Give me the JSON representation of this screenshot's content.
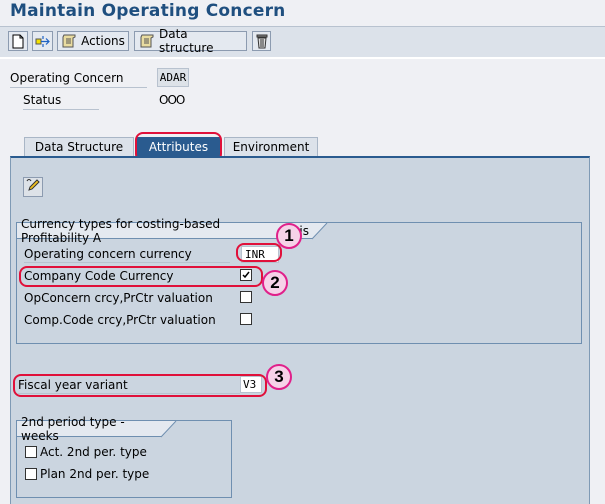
{
  "window": {
    "title": "Maintain Operating Concern"
  },
  "toolbar": {
    "buttons": [
      {
        "icon": "new-document-icon"
      },
      {
        "icon": "transfer-icon"
      },
      {
        "icon": "scroll-icon",
        "label": "Actions"
      },
      {
        "icon": "scroll-icon",
        "label": "Data structure"
      },
      {
        "icon": "trash-icon"
      }
    ]
  },
  "header": {
    "operating_concern_label": "Operating Concern",
    "operating_concern_value": "ADAR",
    "status_label": "Status",
    "status_value": "OOO"
  },
  "tabs": [
    {
      "label": "Data Structure",
      "active": false
    },
    {
      "label": "Attributes",
      "active": true
    },
    {
      "label": "Environment",
      "active": false
    }
  ],
  "currency_group": {
    "title": "Currency types for costing-based Profitability Analysis",
    "title_visible": "Currency types for costing-based Profitability A",
    "title_tail": "is",
    "operating_concern_currency_label": "Operating concern currency",
    "operating_concern_currency_value": "INR",
    "rows": [
      {
        "label": "Company Code Currency",
        "checked": true
      },
      {
        "label": "OpConcern crcy,PrCtr valuation",
        "checked": false
      },
      {
        "label": "Comp.Code crcy,PrCtr valuation",
        "checked": false
      }
    ]
  },
  "fiscal": {
    "label": "Fiscal year variant",
    "value": "V3"
  },
  "period_group": {
    "title": "2nd period type - weeks",
    "rows": [
      {
        "label": "Act. 2nd per. type",
        "checked": false
      },
      {
        "label": "Plan 2nd per. type",
        "checked": false
      }
    ]
  },
  "annotations": [
    "1",
    "2",
    "3"
  ],
  "colors": {
    "title": "#1f4f7f",
    "active_tab": "#2a5b8f",
    "highlight": "#e0103a",
    "badge_fill": "#f6d2e8"
  }
}
